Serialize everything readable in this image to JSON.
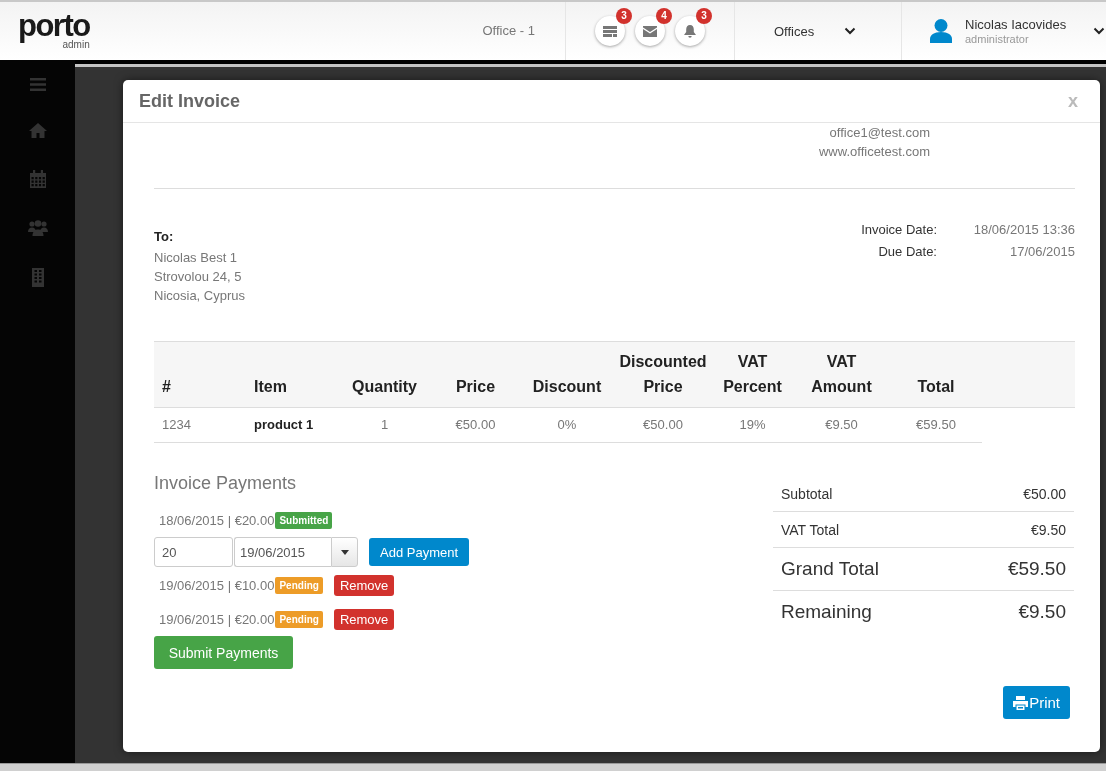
{
  "header": {
    "logo": {
      "name": "porto",
      "subtitle": "admin"
    },
    "office": "Office - 1",
    "notifications": [
      {
        "kind": "tasks",
        "count": "3"
      },
      {
        "kind": "messages",
        "count": "4"
      },
      {
        "kind": "alerts",
        "count": "3"
      }
    ],
    "office_menu": {
      "label": "Offices"
    },
    "user": {
      "name": "Nicolas Iacovides",
      "role": "administrator"
    }
  },
  "modal": {
    "title": "Edit Invoice",
    "close": "x",
    "contact": [
      "office1@test.com",
      "www.officetest.com"
    ],
    "recipient": {
      "label": "To:",
      "lines": [
        "Nicolas Best 1",
        "Strovolou 24, 5",
        "Nicosia, Cyprus"
      ]
    },
    "dates": [
      {
        "label": "Invoice Date:",
        "value": "18/06/2015 13:36"
      },
      {
        "label": "Due Date:",
        "value": "17/06/2015"
      }
    ],
    "items_table": {
      "columns": [
        "#",
        "Item",
        "Quantity",
        "Price",
        "Discount",
        "Discounted Price",
        "VAT Percent",
        "VAT Amount",
        "Total"
      ],
      "rows": [
        [
          "1234",
          "product 1",
          "1",
          "€50.00",
          "0%",
          "€50.00",
          "19%",
          "€9.50",
          "€59.50"
        ]
      ]
    },
    "payments": {
      "title": "Invoice Payments",
      "submitted_entries": [
        {
          "text": "18/06/2015 | €20.00",
          "status": "Submitted",
          "kind": "submitted"
        }
      ],
      "form": {
        "amount": "20",
        "date": "19/06/2015",
        "button": "Add Payment"
      },
      "pending_entries": [
        {
          "text": "19/06/2015 | €10.00",
          "status": "Pending",
          "kind": "pending",
          "action": "Remove"
        },
        {
          "text": "19/06/2015 | €20.00",
          "status": "Pending",
          "kind": "pending",
          "action": "Remove"
        }
      ],
      "submit": "Submit Payments"
    },
    "totals": [
      {
        "label": "Subtotal",
        "value": "€50.00",
        "kind": "regular"
      },
      {
        "label": "VAT Total",
        "value": "€9.50",
        "kind": "regular"
      },
      {
        "label": "Grand Total",
        "value": "€59.50",
        "kind": "large"
      },
      {
        "label": "Remaining",
        "value": "€9.50",
        "kind": "large"
      }
    ],
    "print": "Print"
  }
}
